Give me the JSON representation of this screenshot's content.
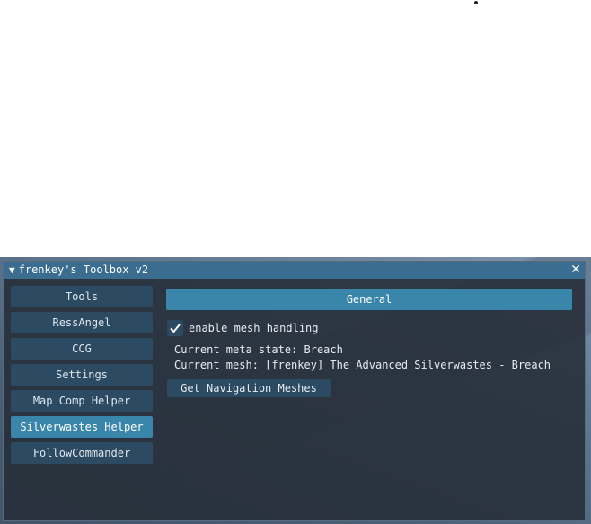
{
  "window": {
    "title": "frenkey's Toolbox v2",
    "collapse_glyph": "▼",
    "close_glyph": "✕"
  },
  "sidebar": {
    "items": [
      {
        "label": "Tools",
        "active": false
      },
      {
        "label": "RessAngel",
        "active": false
      },
      {
        "label": "CCG",
        "active": false
      },
      {
        "label": "Settings",
        "active": false
      },
      {
        "label": "Map Comp Helper",
        "active": false
      },
      {
        "label": "Silverwastes Helper",
        "active": true
      },
      {
        "label": "FollowCommander",
        "active": false
      }
    ]
  },
  "content": {
    "tab_label": "General",
    "checkbox": {
      "label": "enable mesh handling",
      "checked": true
    },
    "meta_state": "Current meta state: Breach",
    "current_mesh": "Current mesh: [frenkey] The Advanced Silverwastes - Breach",
    "nav_mesh_button": "Get Navigation Meshes"
  },
  "colors": {
    "titlebar": "#3a6d8f",
    "active_button": "#3a86aa",
    "button": "#2c4a62",
    "panel": "#262e38"
  }
}
